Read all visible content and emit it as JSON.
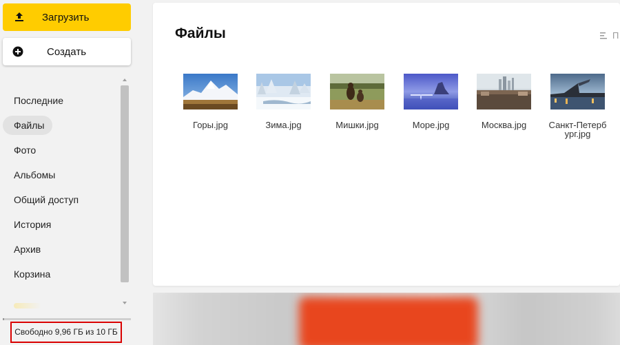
{
  "sidebar": {
    "upload_label": "Загрузить",
    "create_label": "Создать",
    "items": [
      {
        "label": "Последние",
        "active": false
      },
      {
        "label": "Файлы",
        "active": true
      },
      {
        "label": "Фото",
        "active": false
      },
      {
        "label": "Альбомы",
        "active": false
      },
      {
        "label": "Общий доступ",
        "active": false
      },
      {
        "label": "История",
        "active": false
      },
      {
        "label": "Архив",
        "active": false
      },
      {
        "label": "Корзина",
        "active": false
      }
    ],
    "storage": {
      "text": "Свободно 9,96 ГБ из 10 ГБ",
      "used_fraction": 0.004
    }
  },
  "main": {
    "title": "Файлы",
    "sort_label": "П",
    "files": [
      {
        "name": "Горы.jpg",
        "thumb": "mountains"
      },
      {
        "name": "Зима.jpg",
        "thumb": "winter"
      },
      {
        "name": "Мишки.jpg",
        "thumb": "bears"
      },
      {
        "name": "Море.jpg",
        "thumb": "sea"
      },
      {
        "name": "Москва.jpg",
        "thumb": "moscow"
      },
      {
        "name": "Санкт-Петерб\nург.jpg",
        "thumb": "spb"
      }
    ]
  },
  "colors": {
    "accent_yellow": "#ffcc00",
    "storage_outline": "#d90000",
    "banner_red": "#e8461e"
  },
  "icons": {
    "upload": "upload-arrow-icon",
    "create": "plus-circle-icon",
    "sort": "sort-lines-icon",
    "scroll_up": "triangle-up-icon",
    "scroll_down": "triangle-down-icon"
  }
}
